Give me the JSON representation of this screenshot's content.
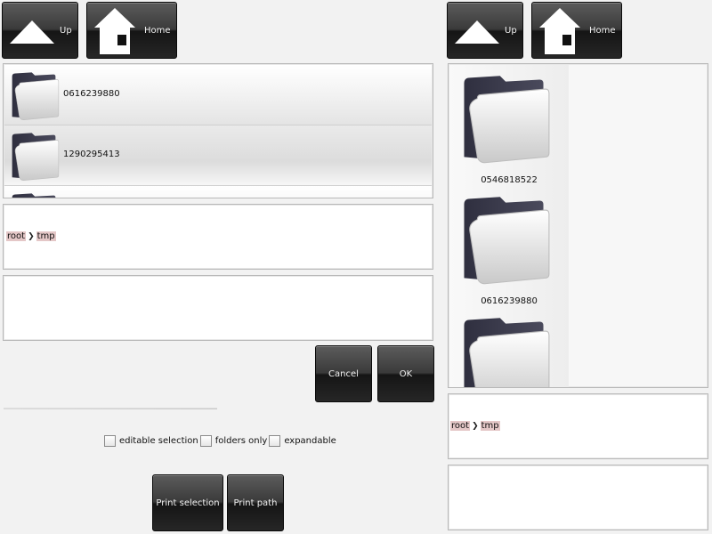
{
  "left": {
    "toolbar": {
      "up_label": "Up",
      "home_label": "Home"
    },
    "list": {
      "items": [
        {
          "name": "0616239880"
        },
        {
          "name": "1290295413"
        }
      ]
    },
    "path": {
      "segments": [
        "root",
        "tmp"
      ]
    },
    "dialog": {
      "cancel_label": "Cancel",
      "ok_label": "OK"
    },
    "options": {
      "editable_selection": "editable selection",
      "folders_only": "folders only",
      "expandable": "expandable"
    },
    "actions": {
      "print_selection": "Print selection",
      "print_path": "Print path"
    }
  },
  "right": {
    "toolbar": {
      "up_label": "Up",
      "home_label": "Home"
    },
    "grid": {
      "items": [
        {
          "name": "0546818522"
        },
        {
          "name": "0616239880"
        }
      ]
    },
    "path": {
      "segments": [
        "root",
        "tmp"
      ]
    }
  },
  "icons": {
    "up": "up-arrow-icon",
    "home": "home-icon",
    "folder": "folder-icon",
    "separator": "chevron-right-icon"
  }
}
